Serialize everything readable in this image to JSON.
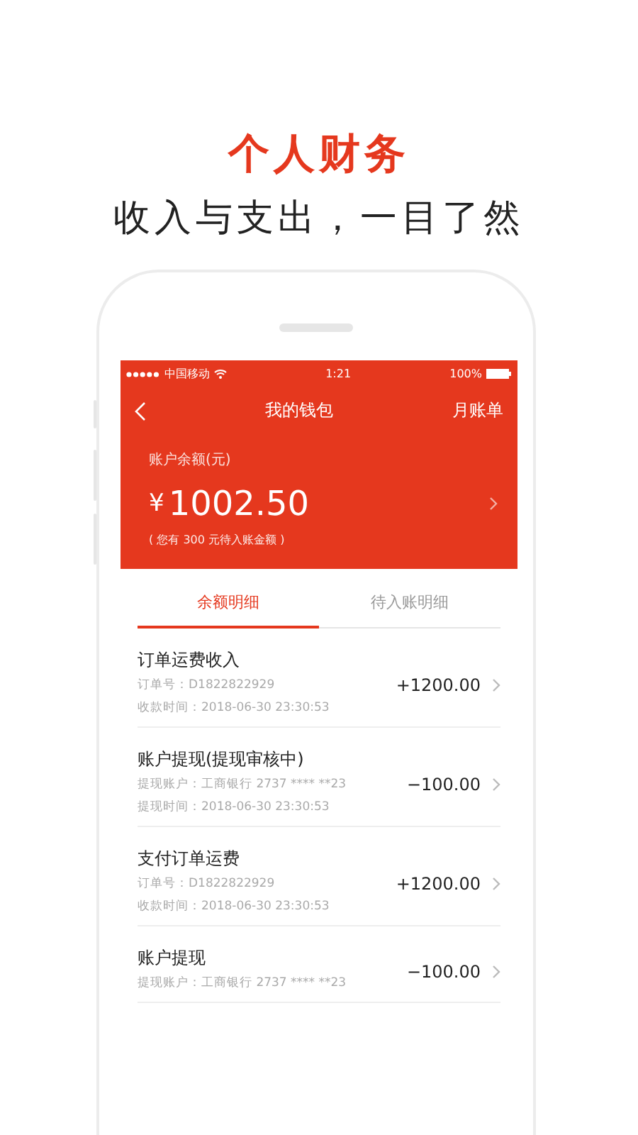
{
  "promo": {
    "title": "个人财务",
    "subtitle": "收入与支出，一目了然"
  },
  "status_bar": {
    "carrier": "中国移动",
    "time": "1:21",
    "battery": "100%"
  },
  "nav": {
    "title": "我的钱包",
    "action": "月账单"
  },
  "balance": {
    "label": "账户余额(元)",
    "currency": "¥",
    "amount": "1002.50",
    "note": "( 您有 300 元待入账金额 )"
  },
  "tabs": [
    {
      "label": "余额明细",
      "selected": true
    },
    {
      "label": "待入账明细",
      "selected": false
    }
  ],
  "records": [
    {
      "title": "订单运费收入",
      "line_1": "订单号：D1822822929",
      "line_2": "收款时间：2018-06-30 23:30:53",
      "amount": "+1200.00"
    },
    {
      "title": "账户提现(提现审核中)",
      "line_1": "提现账户：工商银行 2737 **** **23",
      "line_2": "提现时间：2018-06-30 23:30:53",
      "amount": "−100.00"
    },
    {
      "title": "支付订单运费",
      "line_1": "订单号：D1822822929",
      "line_2": "收款时间：2018-06-30 23:30:53",
      "amount": "+1200.00"
    },
    {
      "title": "账户提现",
      "line_1": "提现账户：工商银行 2737 **** **23",
      "amount": "−100.00"
    }
  ]
}
